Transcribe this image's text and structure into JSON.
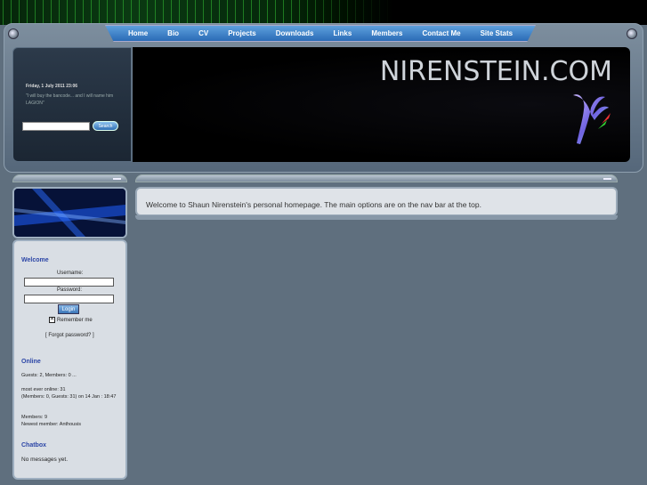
{
  "nav": [
    "Home",
    "Bio",
    "CV",
    "Projects",
    "Downloads",
    "Links",
    "Members",
    "Contact Me",
    "Site Stats"
  ],
  "header": {
    "date": "Friday, 1 July 2011 23:06",
    "quote": "\"I will buy the bancode... and I will name him LAGION\"",
    "search_button": "Search",
    "site_title": "NIRENSTEIN.COM"
  },
  "login": {
    "title": "Welcome",
    "username_label": "Username:",
    "password_label": "Password:",
    "login_button": "Login",
    "remember_label": "Remember me",
    "remember_checked": true,
    "forgot": "[ Forgot password? ]"
  },
  "online": {
    "title": "Online",
    "counts": "Guests: 2, Members: 0 ...",
    "most_ever": "most ever online: 31",
    "most_ever_detail": "(Members: 0, Guests: 31) on 14 Jan : 18:47",
    "members": "Members: 9",
    "newest": "Newest member: Anthousis"
  },
  "chatbox": {
    "title": "Chatbox",
    "message": "No messages yet."
  },
  "main": {
    "welcome_text": "Welcome to Shaun Nirenstein's personal homepage. The main options are on the nav bar at the top."
  }
}
